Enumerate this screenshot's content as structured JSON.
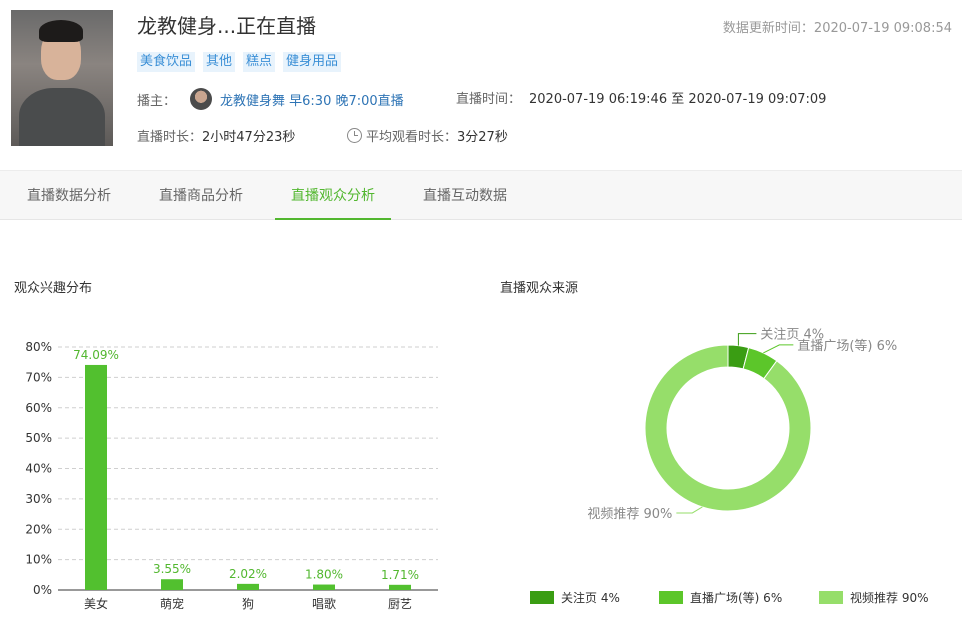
{
  "header": {
    "title": "龙教健身...正在直播",
    "update_time": "数据更新时间：2020-07-19 09:08:54",
    "tags": [
      "美食饮品",
      "其他",
      "糕点",
      "健身用品"
    ],
    "anchor_label": "播主：",
    "anchor_name": "龙教健身舞 早6:30 晚7:00直播",
    "live_time_label": "直播时间：",
    "live_time_value": "2020-07-19 06:19:46 至 2020-07-19 09:07:09",
    "duration_label": "直播时长：",
    "duration_value": "2小时47分23秒",
    "avg_watch_label": "平均观看时长：",
    "avg_watch_value": "3分27秒"
  },
  "tabs": [
    {
      "label": "直播数据分析",
      "active": false
    },
    {
      "label": "直播商品分析",
      "active": false
    },
    {
      "label": "直播观众分析",
      "active": true
    },
    {
      "label": "直播互动数据",
      "active": false
    }
  ],
  "sections": {
    "interest_title": "观众兴趣分布",
    "source_title": "直播观众来源"
  },
  "colors": {
    "accent": "#52b72f",
    "bar": "#52c02f",
    "pie": [
      "#3a9d13",
      "#5cc62a",
      "#96de6a"
    ]
  },
  "chart_data": [
    {
      "type": "bar",
      "categories": [
        "美女",
        "萌宠",
        "狗",
        "唱歌",
        "厨艺"
      ],
      "values": [
        74.09,
        3.55,
        2.02,
        1.8,
        1.71
      ],
      "value_labels": [
        "74.09%",
        "3.55%",
        "2.02%",
        "1.80%",
        "1.71%"
      ],
      "y_ticks": [
        "0%",
        "10%",
        "20%",
        "30%",
        "40%",
        "50%",
        "60%",
        "70%",
        "80%"
      ],
      "ylim": [
        0,
        80
      ],
      "grid": true
    },
    {
      "type": "pie",
      "donut": true,
      "labels": [
        "关注页",
        "直播广场(等)",
        "视频推荐"
      ],
      "values": [
        4,
        6,
        90
      ],
      "slice_labels": [
        "关注页 4%",
        "直播广场(等) 6%",
        "视频推荐 90%"
      ],
      "legend": [
        "关注页 4%",
        "直播广场(等) 6%",
        "视频推荐 90%"
      ],
      "legend_position": "bottom"
    }
  ]
}
